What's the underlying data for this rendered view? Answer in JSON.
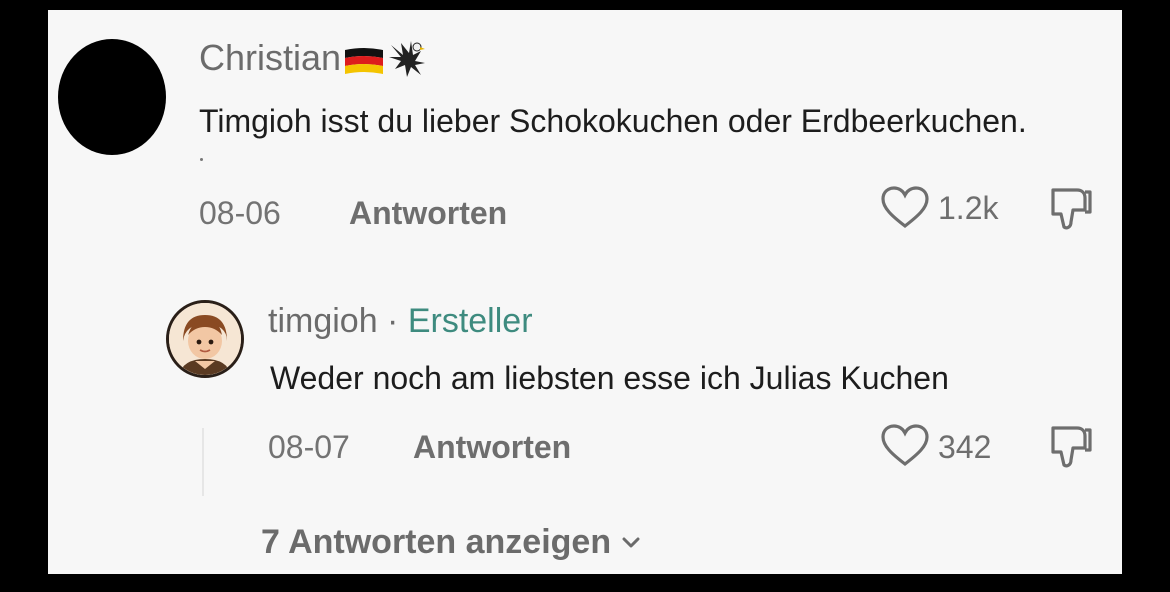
{
  "comment": {
    "username": "Christian",
    "text": "Timgioh isst du lieber Schokokuchen oder Erdbeerkuchen.",
    "date": "08-06",
    "reply_label": "Antworten",
    "likes": "1.2k"
  },
  "reply": {
    "username": "timgioh",
    "separator": " · ",
    "badge": "Ersteller",
    "text": "Weder noch am liebsten esse ich Julias Kuchen",
    "date": "08-07",
    "reply_label": "Antworten",
    "likes": "342"
  },
  "view_replies": "7 Antworten anzeigen",
  "colors": {
    "creator_badge": "#3e8b7f",
    "panel_bg": "#f7f7f7"
  },
  "icons": [
    "german-flag-icon",
    "eagle-icon",
    "heart-icon",
    "dislike-icon",
    "chevron-down-icon"
  ]
}
